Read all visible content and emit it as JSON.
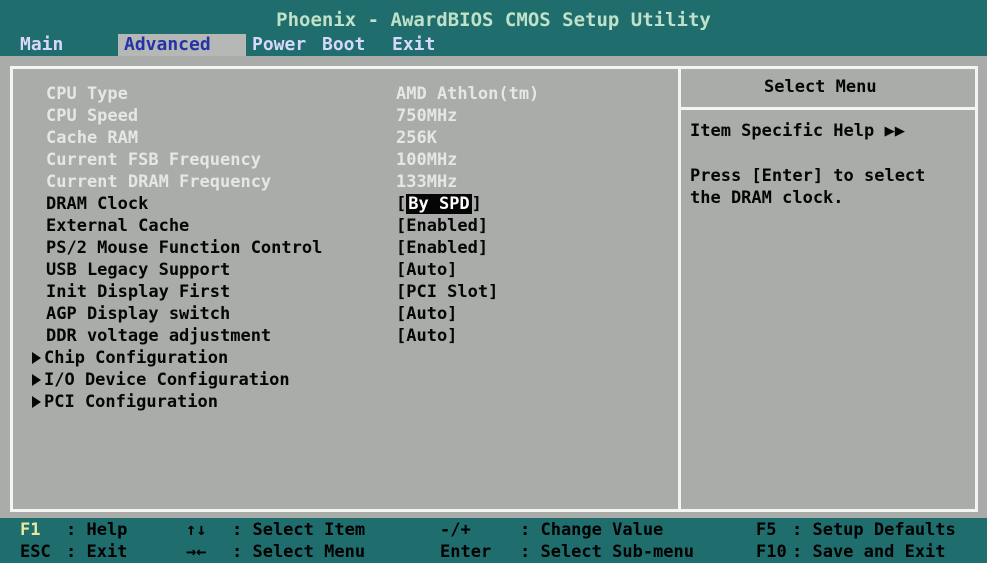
{
  "app": {
    "title": "Phoenix - AwardBIOS CMOS Setup Utility"
  },
  "menu": {
    "items": [
      {
        "label": "Main"
      },
      {
        "label": "Advanced"
      },
      {
        "label": "Power"
      },
      {
        "label": "Boot"
      },
      {
        "label": "Exit"
      }
    ],
    "active": "Advanced"
  },
  "settings": {
    "rows": [
      {
        "label": "CPU Type",
        "value": "AMD Athlon(tm)"
      },
      {
        "label": "CPU Speed",
        "value": "750MHz"
      },
      {
        "label": "Cache RAM",
        "value": "256K"
      },
      {
        "label": "Current FSB Frequency",
        "value": "100MHz"
      },
      {
        "label": "Current DRAM Frequency",
        "value": "133MHz"
      },
      {
        "label": "DRAM Clock",
        "value": "By SPD"
      },
      {
        "label": "External Cache",
        "value": "[Enabled]"
      },
      {
        "label": "PS/2 Mouse Function Control",
        "value": "[Enabled]"
      },
      {
        "label": "USB Legacy Support",
        "value": "[Auto]"
      },
      {
        "label": "Init Display First",
        "value": "[PCI Slot]"
      },
      {
        "label": "AGP Display switch",
        "value": "[Auto]"
      },
      {
        "label": "DDR voltage adjustment",
        "value": "[Auto]"
      }
    ],
    "submenus": [
      {
        "label": "Chip Configuration"
      },
      {
        "label": "I/O Device Configuration"
      },
      {
        "label": "PCI Configuration"
      }
    ],
    "bracket_open": "[",
    "bracket_close": "]"
  },
  "help": {
    "header": "Select Menu",
    "item_help": "Item Specific Help ▶▶",
    "line1": "Press [Enter] to select",
    "line2": "the DRAM clock."
  },
  "footer": {
    "row1": [
      {
        "key": "F1",
        "text": ": Help"
      },
      {
        "key": "↑↓",
        "text": ": Select Item"
      },
      {
        "key": "-/+",
        "text": ": Change Value"
      },
      {
        "key": "F5",
        "text": ": Setup Defaults"
      }
    ],
    "row2": [
      {
        "key": "ESC",
        "text": ": Exit"
      },
      {
        "key": "→←",
        "text": ": Select Menu"
      },
      {
        "key": "Enter",
        "text": ": Select Sub-menu"
      },
      {
        "key": "F10",
        "text": ": Save and Exit"
      }
    ]
  },
  "colors": {
    "background": "#a9aca9",
    "bar": "#1f6d6c",
    "accent": "#2433a8"
  }
}
